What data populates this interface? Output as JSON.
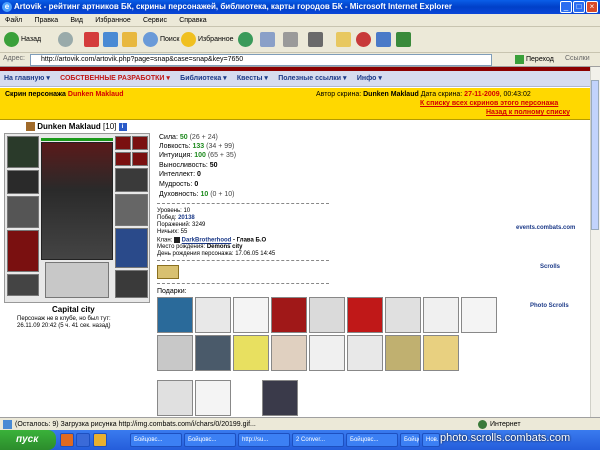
{
  "window": {
    "title": "Artovik - рейтинг артников БК, скрины персонажей, библиотека, карты городов БК - Microsoft Internet Explorer",
    "icon": "ie-icon"
  },
  "menu": [
    "Файл",
    "Правка",
    "Вид",
    "Избранное",
    "Сервис",
    "Справка"
  ],
  "toolbar": {
    "back": "Назад",
    "search": "Поиск",
    "favorites": "Избранное"
  },
  "address": {
    "label": "Адрес:",
    "url": "http://artovik.com/artovik.php?page=snap&case=snap&key=7650",
    "go": "Переход",
    "links": "Ссылки"
  },
  "nav": [
    "На главную ▾",
    "СОБСТВЕННЫЕ РАЗРАБОТКИ ▾",
    "Библиотека ▾",
    "Квесты ▾",
    "Полезные ссылки ▾",
    "Инфо ▾"
  ],
  "header": {
    "skin_label": "Скрин персонажа",
    "char_name": "Dunken Maklaud",
    "author_label": "Автор скрина:",
    "author": "Dunken Maklaud",
    "date_label": "Дата скрина:",
    "date": "27-11-2009",
    "time": ", 00:43:02",
    "link1": "К списку всех скринов этого персонажа",
    "link2": "Назад к полному списку"
  },
  "character": {
    "name": "Dunken Maklaud",
    "level": "[10]",
    "city": "Capital city",
    "status": "Персонаж не в клубе, но был тут:",
    "last_seen": "26.11.09 20:42 (5 ч. 41 сек. назад)"
  },
  "stats": [
    {
      "label": "Сила:",
      "value": "50",
      "extra": "(26 + 24)"
    },
    {
      "label": "Ловкость:",
      "value": "133",
      "extra": "(34 + 99)"
    },
    {
      "label": "Интуиция:",
      "value": "100",
      "extra": "(65 + 35)"
    },
    {
      "label": "Выносливость:",
      "value": "50",
      "extra": ""
    },
    {
      "label": "Интеллект:",
      "value": "0",
      "extra": ""
    },
    {
      "label": "Мудрость:",
      "value": "0",
      "extra": ""
    },
    {
      "label": "Духовность:",
      "value": "10",
      "extra": "(0 + 10)"
    }
  ],
  "info": {
    "level": "Уровень: 10",
    "wins_label": "Побед:",
    "wins": "20138",
    "losses": "Поражений: 3249",
    "draws": "Ничьих: 55",
    "clan_label": "Клан:",
    "clan": "DarkBrotherhood",
    "clan_rank": " - Глава Б.О",
    "birthplace_label": "Место рождения:",
    "birthplace": "Demons city",
    "birthday": "День рождения персонажа: 17.06.05 14:45"
  },
  "gifts_label": "Подарки:",
  "side_links": [
    "events.combats.com",
    "Scrolls",
    "Photo Scrolls"
  ],
  "statusbar": {
    "text": "(Осталось: 9) Загрузка рисунка http://img.combats.com/i/chars/0/20199.gif...",
    "zone": "Интернет"
  },
  "taskbar": {
    "start": "пуск",
    "tasks": [
      "Бойцовс...",
      "Бойцовс...",
      "http://su...",
      "2 Conver...",
      "Бойцовс...",
      "Бойцовс...",
      "Нов..."
    ],
    "watermark": "photo.scrolls.combats.com"
  },
  "colors": {
    "accent_red": "#d40000",
    "stat_green": "#1d8a1d",
    "header_yellow": "#ffd800"
  }
}
